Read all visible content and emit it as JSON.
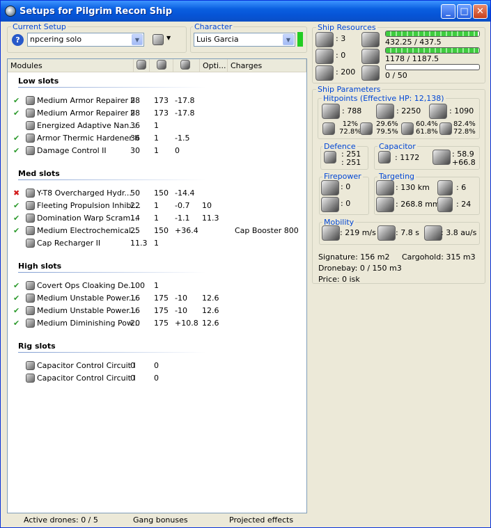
{
  "window": {
    "title": "Setups for Pilgrim Recon Ship",
    "minimize": "_",
    "maximize": "□",
    "close": "✕"
  },
  "current_setup": {
    "label": "Current Setup",
    "value": "npcering solo"
  },
  "character": {
    "label": "Character",
    "value": "Luis Garcia",
    "status_color": "#22cc22"
  },
  "modules_header": {
    "modules": "Modules",
    "opti": "Opti...",
    "charges": "Charges"
  },
  "sections": {
    "low": {
      "title": "Low slots",
      "rows": [
        {
          "status": "ok",
          "name": "Medium Armor Repairer II",
          "c1": "28",
          "c2": "173",
          "c3": "-17.8",
          "opti": "",
          "charges": ""
        },
        {
          "status": "ok",
          "name": "Medium Armor Repairer II",
          "c1": "28",
          "c2": "173",
          "c3": "-17.8",
          "opti": "",
          "charges": ""
        },
        {
          "status": "",
          "name": "Energized Adaptive Nan...",
          "c1": "36",
          "c2": "1",
          "c3": "",
          "opti": "",
          "charges": ""
        },
        {
          "status": "ok",
          "name": "Armor Thermic Hardener II",
          "c1": "36",
          "c2": "1",
          "c3": "-1.5",
          "opti": "",
          "charges": ""
        },
        {
          "status": "ok",
          "name": "Damage Control II",
          "c1": "30",
          "c2": "1",
          "c3": "0",
          "opti": "",
          "charges": ""
        }
      ]
    },
    "med": {
      "title": "Med slots",
      "rows": [
        {
          "status": "err",
          "name": "Y-T8 Overcharged Hydr...",
          "c1": "50",
          "c2": "150",
          "c3": "-14.4",
          "opti": "",
          "charges": ""
        },
        {
          "status": "ok",
          "name": "Fleeting Propulsion Inhibi...",
          "c1": "22",
          "c2": "1",
          "c3": "-0.7",
          "opti": "10",
          "charges": ""
        },
        {
          "status": "ok",
          "name": "Domination Warp Scram...",
          "c1": "14",
          "c2": "1",
          "c3": "-1.1",
          "opti": "11.3",
          "charges": ""
        },
        {
          "status": "ok",
          "name": "Medium Electrochemical...",
          "c1": "25",
          "c2": "150",
          "c3": "+36.4",
          "opti": "",
          "charges": "Cap Booster 800"
        },
        {
          "status": "",
          "name": "Cap Recharger II",
          "c1": "11.3",
          "c2": "1",
          "c3": "",
          "opti": "",
          "charges": ""
        }
      ]
    },
    "high": {
      "title": "High slots",
      "rows": [
        {
          "status": "ok",
          "name": "Covert Ops Cloaking De...",
          "c1": "100",
          "c2": "1",
          "c3": "",
          "opti": "",
          "charges": ""
        },
        {
          "status": "ok",
          "name": "Medium Unstable Power...",
          "c1": "16",
          "c2": "175",
          "c3": "-10",
          "opti": "12.6",
          "charges": ""
        },
        {
          "status": "ok",
          "name": "Medium Unstable Power...",
          "c1": "16",
          "c2": "175",
          "c3": "-10",
          "opti": "12.6",
          "charges": ""
        },
        {
          "status": "ok",
          "name": "Medium Diminishing Pow...",
          "c1": "20",
          "c2": "175",
          "c3": "+10.8",
          "opti": "12.6",
          "charges": ""
        }
      ]
    },
    "rig": {
      "title": "Rig slots",
      "rows": [
        {
          "status": "",
          "name": "Capacitor Control Circuit I",
          "c1": "0",
          "c2": "0",
          "c3": "",
          "opti": "",
          "charges": ""
        },
        {
          "status": "",
          "name": "Capacitor Control Circuit I",
          "c1": "0",
          "c2": "0",
          "c3": "",
          "opti": "",
          "charges": ""
        }
      ]
    }
  },
  "statusbar": {
    "drones": "Active drones: 0 / 5",
    "gang": "Gang bonuses",
    "projected": "Projected effects"
  },
  "resources": {
    "label": "Ship Resources",
    "turrets": ": 3",
    "launchers": ": 0",
    "calibration": ": 200",
    "cpu": "432.25 / 437.5",
    "cpu_fill": 0.988,
    "power": "1178 / 1187.5",
    "power_fill": 0.992,
    "drones": "0 / 50",
    "drones_fill": 0
  },
  "parameters": {
    "label": "Ship Parameters",
    "hitpoints": {
      "label": "Hitpoints (Effective HP: 12,138)",
      "shield": ": 788",
      "armor": ": 2250",
      "structure": ": 1090",
      "em": [
        "12%",
        "72.8%"
      ],
      "thermal": [
        "29.6%",
        "79.5%"
      ],
      "kinetic": [
        "60.4%",
        "61.8%"
      ],
      "explosive": [
        "82.4%",
        "72.8%"
      ]
    },
    "defence": {
      "label": "Defence",
      "v1": ": 251",
      "v2": ": 251"
    },
    "capacitor": {
      "label": "Capacitor",
      "amount": ": 1172",
      "v1": ": 58.9",
      "v2": "+66.8"
    },
    "firepower": {
      "label": "Firepower",
      "v1": ": 0",
      "v2": ": 0"
    },
    "targeting": {
      "label": "Targeting",
      "range": ": 130 km",
      "targets": ": 6",
      "resolution": ": 268.8 mm",
      "sensor": ": 24"
    },
    "mobility": {
      "label": "Mobility",
      "speed": ": 219 m/s",
      "align": ": 7.8 s",
      "warp": ": 3.8 au/s"
    },
    "signature": "Signature: 156 m2",
    "cargohold": "Cargohold: 315 m3",
    "dronebay": "Dronebay: 0 / 150 m3",
    "price": "Price: 0 isk"
  }
}
